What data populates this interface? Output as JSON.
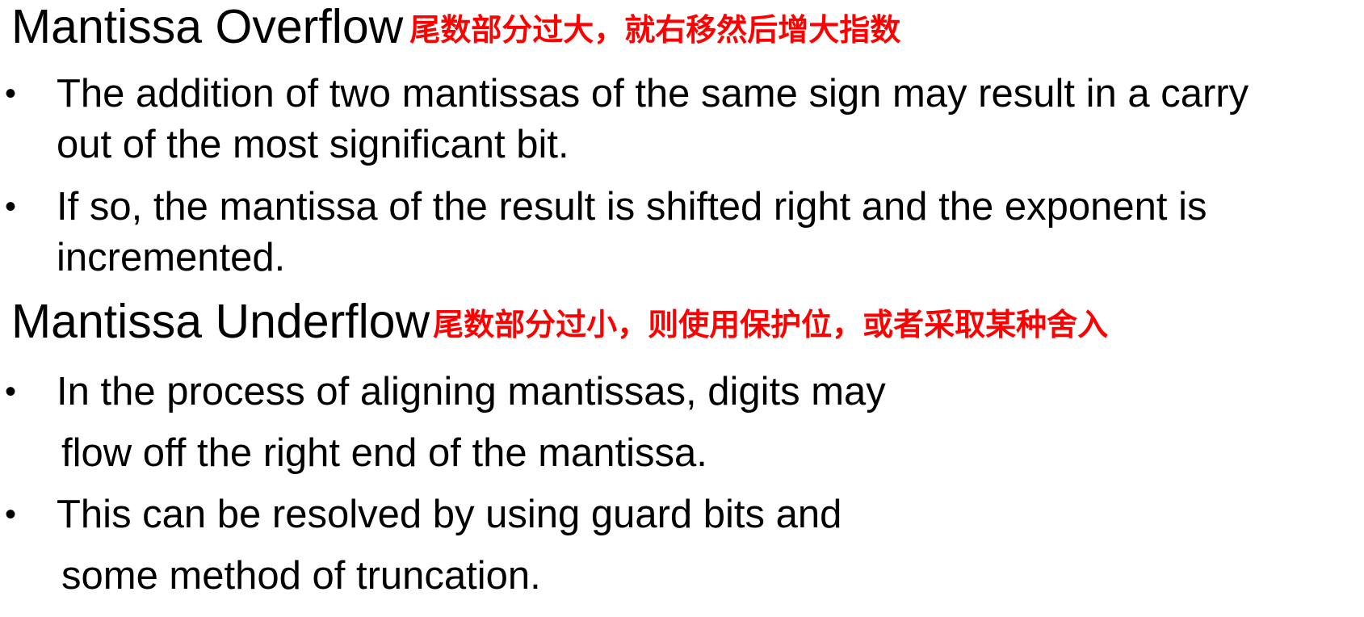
{
  "sections": [
    {
      "title": "Mantissa Overflow",
      "note": "尾数部分过大，就右移然后增大指数",
      "bullets": [
        {
          "lines": [
            "The addition of two mantissas of the same sign may result in a carry",
            "out of the most significant bit."
          ]
        },
        {
          "lines": [
            "If so, the mantissa of the result is shifted right and the exponent is",
            "incremented."
          ]
        }
      ]
    },
    {
      "title": "Mantissa Underflow",
      "note": "尾数部分过小，则使用保护位，或者采取某种舍入",
      "bullets": [
        {
          "lines": [
            "In the process of aligning mantissas, digits may",
            "flow off the right end of the mantissa."
          ]
        },
        {
          "lines": [
            "This can be resolved by using guard bits and",
            "some method of truncation."
          ]
        }
      ]
    }
  ],
  "bullet_symbol": "•",
  "colors": {
    "text": "#000000",
    "note": "#ff0000",
    "background": "#ffffff"
  }
}
